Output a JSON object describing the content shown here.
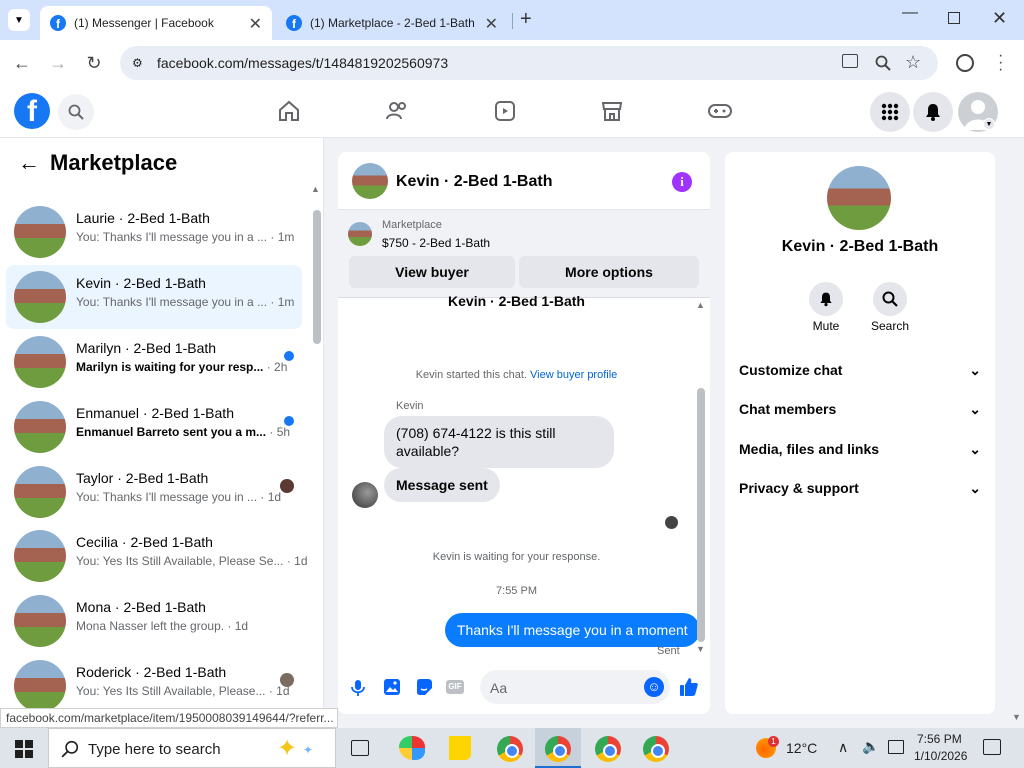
{
  "browser": {
    "tabs": [
      {
        "label": "(1) Messenger | Facebook"
      },
      {
        "label": "(1) Marketplace - 2-Bed 1-Bath"
      }
    ],
    "url": "facebook.com/messages/t/1484819202560973"
  },
  "sidebar": {
    "title": "Marketplace",
    "conversations": [
      {
        "title": "Laurie · 2-Bed 1-Bath",
        "preview": "You: Thanks I'll message you in a ...",
        "time": "· 1m",
        "unread": false
      },
      {
        "title": "Kevin · 2-Bed 1-Bath",
        "preview": "You: Thanks I'll message you in a ...",
        "time": "· 1m",
        "unread": false,
        "selected": true
      },
      {
        "title": "Marilyn · 2-Bed 1-Bath",
        "preview": "Marilyn is waiting for your resp...",
        "time": "· 2h",
        "unread": true
      },
      {
        "title": "Enmanuel · 2-Bed 1-Bath",
        "preview": "Enmanuel Barreto sent you a m...",
        "time": "· 5h",
        "unread": true
      },
      {
        "title": "Taylor · 2-Bed 1-Bath",
        "preview": "You: Thanks I'll message you in ...",
        "time": "· 1d",
        "unread": false
      },
      {
        "title": "Cecilia · 2-Bed 1-Bath",
        "preview": "You: Yes Its Still Available, Please Se...",
        "time": "· 1d",
        "unread": false
      },
      {
        "title": "Mona · 2-Bed 1-Bath",
        "preview": "Mona Nasser left the group.",
        "time": "· 1d",
        "unread": false
      },
      {
        "title": "Roderick · 2-Bed 1-Bath",
        "preview": "You: Yes Its Still Available, Please...",
        "time": "· 1d",
        "unread": false
      }
    ]
  },
  "chat": {
    "header_title": "Kevin · 2-Bed 1-Bath",
    "listing_source": "Marketplace",
    "listing_price": "$750 - 2-Bed 1-Bath",
    "view_buyer": "View buyer",
    "more_options": "More options",
    "thread_name": "Kevin · 2-Bed 1-Bath",
    "started_text": "Kevin started this chat.",
    "buyer_profile_link": "View buyer profile",
    "sender_name": "Kevin",
    "incoming_msg_1": "(708) 674-4122 is this still available?",
    "incoming_msg_2": "Message sent",
    "waiting_text": "Kevin is waiting for your response.",
    "time_divider": "7:55 PM",
    "outgoing_msg": "Thanks I'll message you in a moment",
    "outgoing_status": "Sent",
    "composer_placeholder": "Aa"
  },
  "details": {
    "name": "Kevin · 2-Bed 1-Bath",
    "mute_label": "Mute",
    "search_label": "Search",
    "sections": [
      "Customize chat",
      "Chat members",
      "Media, files and links",
      "Privacy & support"
    ]
  },
  "status_url": "facebook.com/marketplace/item/1950008039149644/?referr...",
  "taskbar": {
    "search_placeholder": "Type here to search",
    "weather": "12°C",
    "time": "7:56 PM",
    "date": "1/10/2026",
    "badge": "1"
  },
  "colors": {
    "accent": "#1877f2",
    "purple": "#a033ff"
  }
}
